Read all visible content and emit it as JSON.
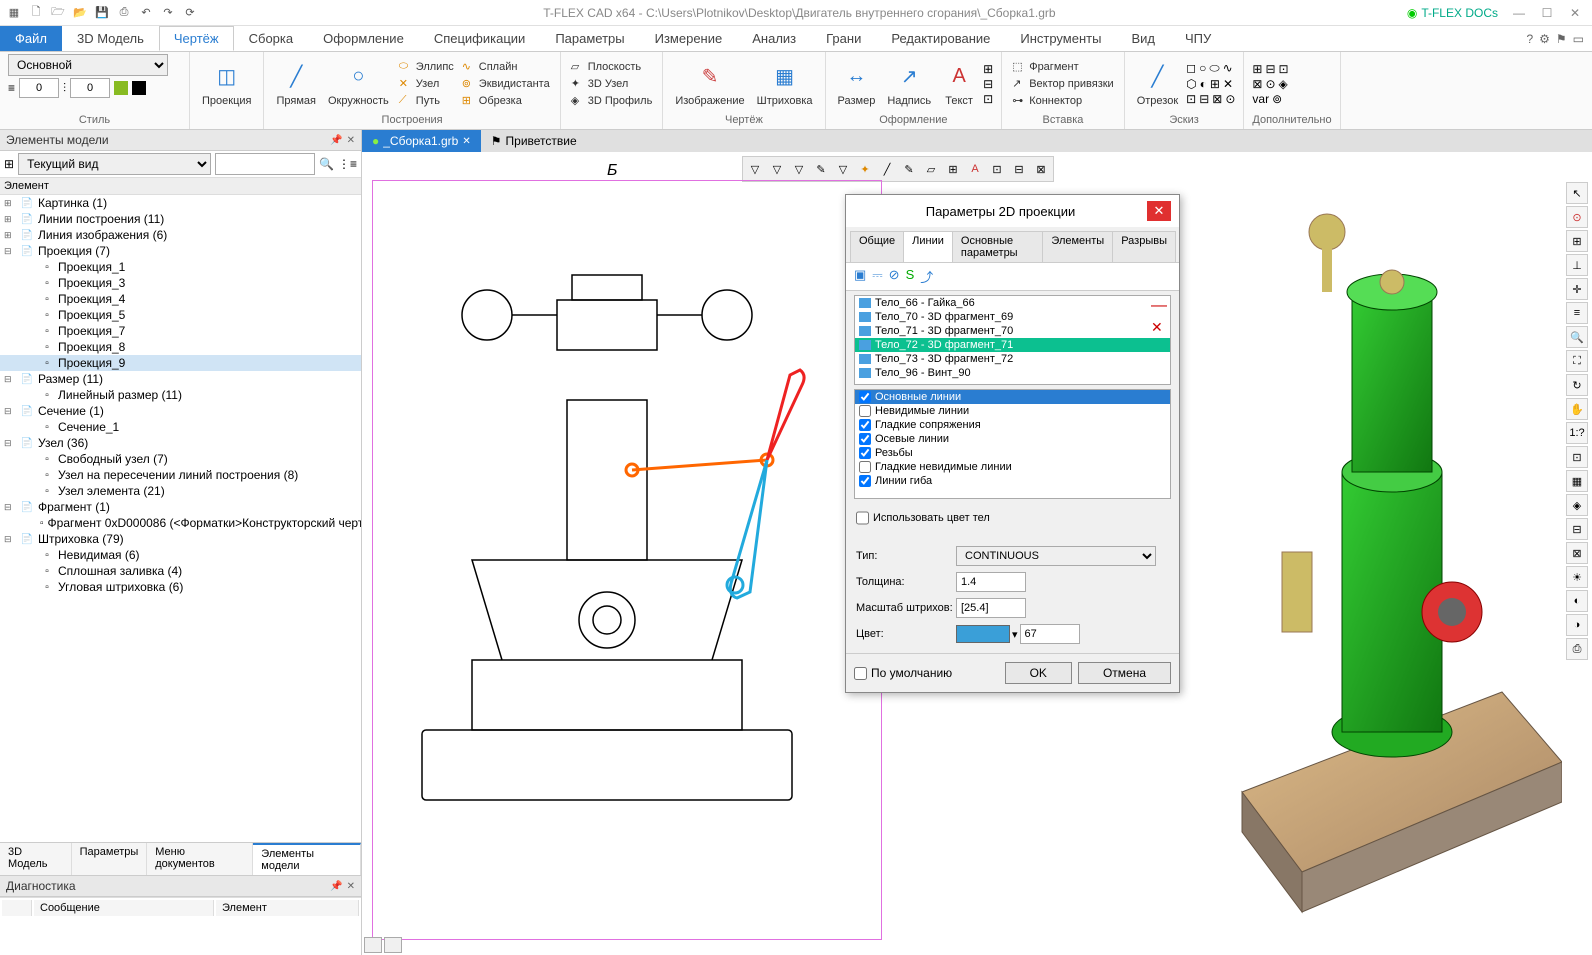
{
  "title": "T-FLEX CAD x64 - C:\\Users\\Plotnikov\\Desktop\\Двигатель внутреннего сгорания\\_Сборка1.grb",
  "docs_btn": "T-FLEX DOCs",
  "maintabs": {
    "file": "Файл",
    "items": [
      "3D Модель",
      "Чертёж",
      "Сборка",
      "Оформление",
      "Спецификации",
      "Параметры",
      "Измерение",
      "Анализ",
      "Грани",
      "Редактирование",
      "Инструменты",
      "Вид",
      "ЧПУ"
    ],
    "active": "Чертёж"
  },
  "ribbon": {
    "style": {
      "combo": "Основной",
      "w": "0",
      "h": "0",
      "label": "Стиль"
    },
    "projection": {
      "btn": "Проекция"
    },
    "direct": {
      "line": "Прямая",
      "circle": "Окружность"
    },
    "build": {
      "ellipse": "Эллипс",
      "spline": "Сплайн",
      "node": "Узел",
      "equi": "Эквидистанта",
      "path": "Путь",
      "trim": "Обрезка",
      "label": "Построения"
    },
    "plane": {
      "plane": "Плоскость",
      "node3d": "3D Узел",
      "profile3d": "3D Профиль"
    },
    "drawing": {
      "image": "Изображение",
      "hatch": "Штриховка",
      "label": "Чертёж"
    },
    "design": {
      "size": "Размер",
      "text": "Надпись",
      "txt": "Текст",
      "label": "Оформление"
    },
    "insert": {
      "fragment": "Фрагмент",
      "vector": "Вектор привязки",
      "connector": "Коннектор",
      "label": "Вставка"
    },
    "sketch": {
      "segment": "Отрезок",
      "label": "Эскиз"
    },
    "extra": {
      "label": "Дополнительно"
    }
  },
  "left_panel": {
    "title": "Элементы модели",
    "view_combo": "Текущий вид",
    "element_header": "Элемент",
    "tree": [
      {
        "t": "Картинка (1)",
        "exp": "+"
      },
      {
        "t": "Линии построения (11)",
        "exp": "+"
      },
      {
        "t": "Линия изображения (6)",
        "exp": "+"
      },
      {
        "t": "Проекция (7)",
        "exp": "-",
        "children": [
          "Проекция_1",
          "Проекция_3",
          "Проекция_4",
          "Проекция_5",
          "Проекция_7",
          "Проекция_8",
          "Проекция_9"
        ],
        "selected_child": 6
      },
      {
        "t": "Размер (11)",
        "exp": "-",
        "children": [
          "Линейный размер (11)"
        ]
      },
      {
        "t": "Сечение (1)",
        "exp": "-",
        "children": [
          "Сечение_1"
        ]
      },
      {
        "t": "Узел (36)",
        "exp": "-",
        "children": [
          "Свободный узел (7)",
          "Узел на пересечении линий построения (8)",
          "Узел элемента (21)"
        ]
      },
      {
        "t": "Фрагмент (1)",
        "exp": "-",
        "children": [
          "Фрагмент 0xD000086 (<Форматки>Конструкторский черт…"
        ]
      },
      {
        "t": "Штриховка (79)",
        "exp": "-",
        "children": [
          "Невидимая (6)",
          "Сплошная заливка (4)",
          "Угловая штриховка (6)"
        ]
      }
    ],
    "tabs": [
      "3D Модель",
      "Параметры",
      "Меню документов",
      "Элементы модели"
    ],
    "active_tab": 3,
    "diag": {
      "title": "Диагностика",
      "cols": [
        "",
        "Сообщение",
        "Элемент"
      ]
    }
  },
  "doc_tabs": [
    {
      "label": "_Сборка1.grb",
      "active": true,
      "icon": "●"
    },
    {
      "label": "Приветствие",
      "active": false,
      "icon": "⚑"
    }
  ],
  "drawing_label": "Б",
  "dialog": {
    "title": "Параметры 2D проекции",
    "tabs": [
      "Общие",
      "Линии",
      "Основные параметры",
      "Элементы",
      "Разрывы"
    ],
    "active_tab": 1,
    "bodies": [
      "Тело_66 - Гайка_66",
      "Тело_70 - 3D фрагмент_69",
      "Тело_71 - 3D фрагмент_70",
      "Тело_72 - 3D фрагмент_71",
      "Тело_73 - 3D фрагмент_72",
      "Тело_96 - Винт_90"
    ],
    "selected_body": 3,
    "checks": [
      {
        "label": "Основные линии",
        "checked": true,
        "sel": true
      },
      {
        "label": "Невидимые линии",
        "checked": false
      },
      {
        "label": "Гладкие сопряжения",
        "checked": true
      },
      {
        "label": "Осевые линии",
        "checked": true
      },
      {
        "label": "Резьбы",
        "checked": true
      },
      {
        "label": "Гладкие невидимые линии",
        "checked": false
      },
      {
        "label": "Линии гиба",
        "checked": true
      }
    ],
    "use_body_color": "Использовать цвет тел",
    "type_label": "Тип:",
    "type_value": "CONTINUOUS",
    "thickness_label": "Толщина:",
    "thickness_value": "1.4",
    "hatch_scale_label": "Масштаб штрихов:",
    "hatch_scale_value": "[25.4]",
    "color_label": "Цвет:",
    "color_value": "67",
    "default_label": "По умолчанию",
    "ok": "OK",
    "cancel": "Отмена"
  }
}
